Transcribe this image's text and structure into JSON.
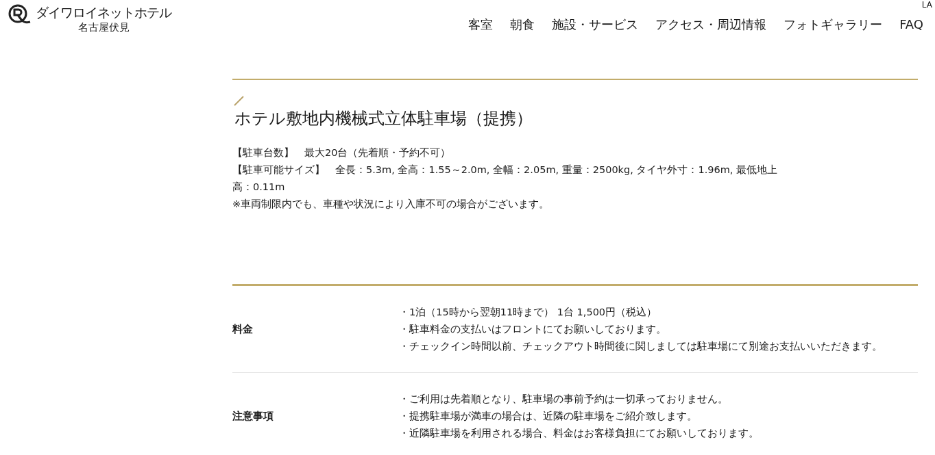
{
  "header": {
    "logo_name": "ダイワロイネットホテル",
    "logo_sub": "名古屋伏見",
    "language": "LA",
    "nav": [
      {
        "label": "客室"
      },
      {
        "label": "朝食"
      },
      {
        "label": "施設・サービス"
      },
      {
        "label": "アクセス・周辺情報"
      },
      {
        "label": "フォトギャラリー"
      },
      {
        "label": "FAQ"
      }
    ]
  },
  "section": {
    "title": "ホテル敷地内機械式立体駐車場（提携）",
    "info": [
      "【駐車台数】　最大20台（先着順・予約不可）",
      "【駐車可能サイズ】　全長：5.3m, 全高：1.55～2.0m, 全幅：2.05m, 重量：2500kg, タイヤ外寸：1.96m, 最低地上高：0.11m",
      "※車両制限内でも、車種や状況により入庫不可の場合がございます。"
    ]
  },
  "table": {
    "rows": [
      {
        "label": "料金",
        "lines": [
          "・1泊（15時から翌朝11時まで） 1台 1,500円（税込）",
          "・駐車料金の支払いはフロントにてお願いしております。",
          "・チェックイン時間以前、チェックアウト時間後に関しましては駐車場にて別途お支払いいただきます。"
        ]
      },
      {
        "label": "注意事項",
        "lines": [
          "・ご利用は先着順となり、駐車場の事前予約は一切承っておりません。",
          "・提携駐車場が満車の場合は、近隣の駐車場をご紹介致します。",
          "・近隣駐車場を利用される場合、料金はお客様負担にてお願いしております。"
        ]
      }
    ]
  }
}
